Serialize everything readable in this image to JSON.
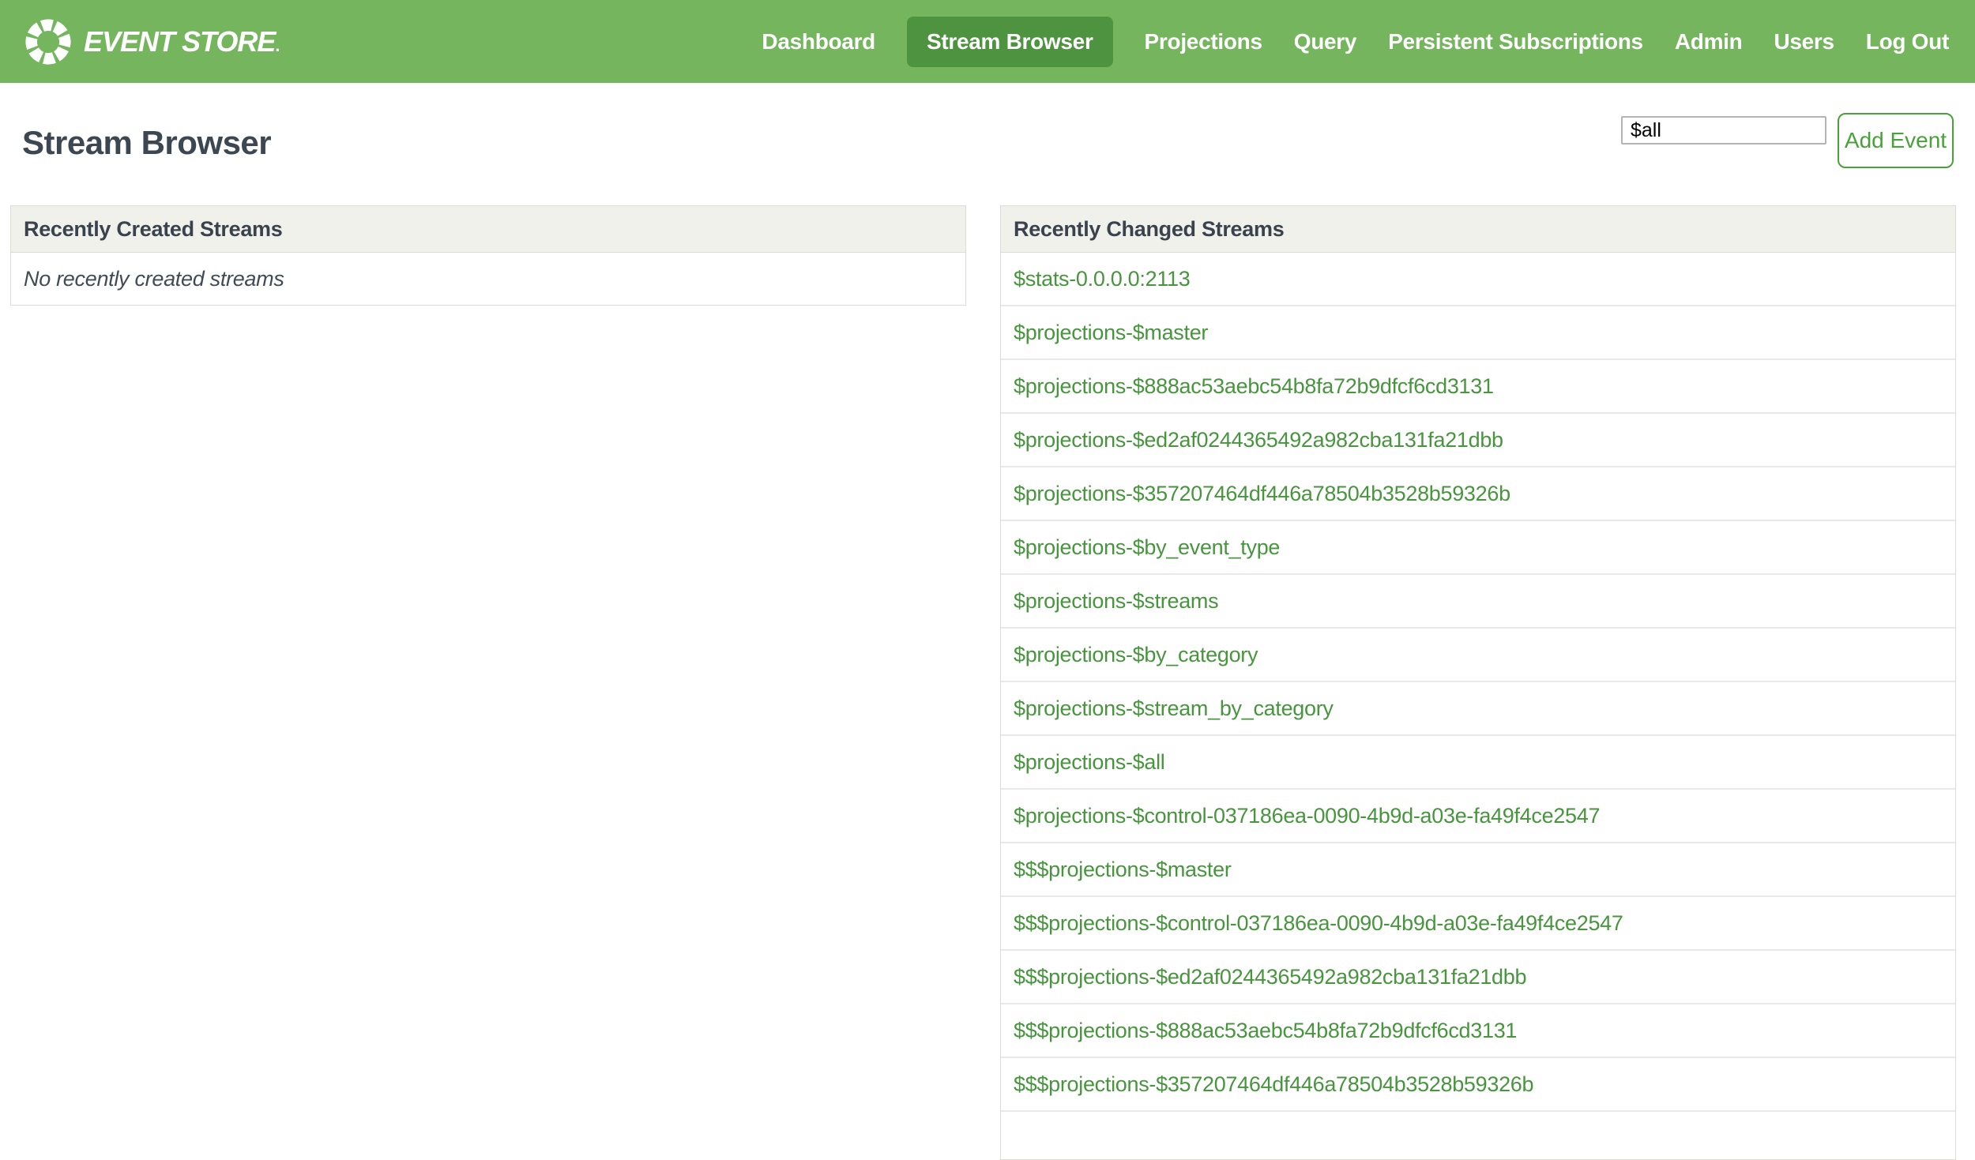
{
  "header": {
    "logo": {
      "text": "EVENT STORE",
      "suffix": "."
    },
    "nav": [
      {
        "label": "Dashboard",
        "active": false
      },
      {
        "label": "Stream Browser",
        "active": true
      },
      {
        "label": "Projections",
        "active": false
      },
      {
        "label": "Query",
        "active": false
      },
      {
        "label": "Persistent Subscriptions",
        "active": false
      },
      {
        "label": "Admin",
        "active": false
      },
      {
        "label": "Users",
        "active": false
      },
      {
        "label": "Log Out",
        "active": false
      }
    ]
  },
  "page": {
    "title": "Stream Browser",
    "stream_input_value": "$all",
    "add_event_label": "Add Event"
  },
  "panels": {
    "created": {
      "title": "Recently Created Streams",
      "empty_message": "No recently created streams"
    },
    "changed": {
      "title": "Recently Changed Streams",
      "streams": [
        "$stats-0.0.0.0:2113",
        "$projections-$master",
        "$projections-$888ac53aebc54b8fa72b9dfcf6cd3131",
        "$projections-$ed2af0244365492a982cba131fa21dbb",
        "$projections-$357207464df446a78504b3528b59326b",
        "$projections-$by_event_type",
        "$projections-$streams",
        "$projections-$by_category",
        "$projections-$stream_by_category",
        "$projections-$all",
        "$projections-$control-037186ea-0090-4b9d-a03e-fa49f4ce2547",
        "$$$projections-$master",
        "$$$projections-$control-037186ea-0090-4b9d-a03e-fa49f4ce2547",
        "$$$projections-$ed2af0244365492a982cba131fa21dbb",
        "$$$projections-$888ac53aebc54b8fa72b9dfcf6cd3131",
        "$$$projections-$357207464df446a78504b3528b59326b"
      ]
    }
  },
  "colors": {
    "header_bg": "#75b55e",
    "nav_active_bg": "#4e9340",
    "link_green": "#47953d",
    "button_green": "#48a139",
    "title_text": "#3d4752",
    "panel_header_bg": "#f0f1eb"
  }
}
